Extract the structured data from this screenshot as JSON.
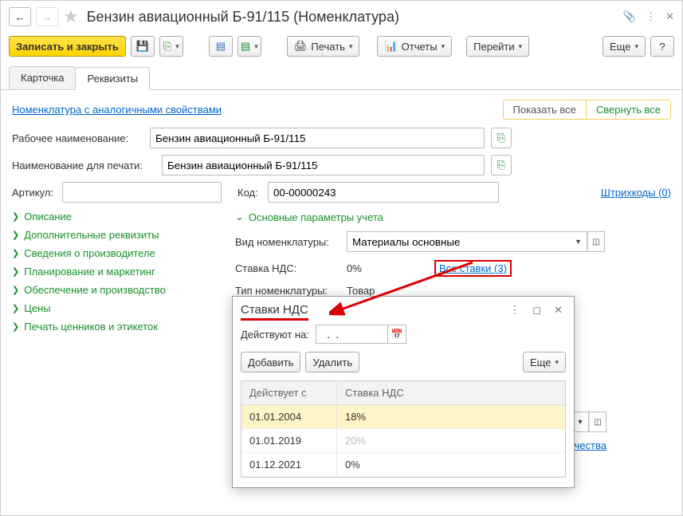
{
  "header": {
    "title": "Бензин авиационный Б-91/115 (Номенклатура)"
  },
  "toolbar": {
    "save_close": "Записать и закрыть",
    "print": "Печать",
    "reports": "Отчеты",
    "goto": "Перейти",
    "more": "Еще"
  },
  "tabs": {
    "card": "Карточка",
    "props": "Реквизиты"
  },
  "top": {
    "similar_link": "Номенклатура с аналогичными свойствами",
    "show_all": "Показать все",
    "collapse_all": "Свернуть все"
  },
  "fields": {
    "work_name_label": "Рабочее наименование:",
    "work_name_value": "Бензин авиационный Б-91/115",
    "print_name_label": "Наименование для печати:",
    "print_name_value": "Бензин авиационный Б-91/115",
    "article_label": "Артикул:",
    "article_value": "",
    "code_label": "Код:",
    "code_value": "00-00000243",
    "barcodes_link": "Штрихкоды (0)"
  },
  "tree": {
    "i0": "Описание",
    "i1": "Дополнительные реквизиты",
    "i2": "Сведения о производителе",
    "i3": "Планирование и маркетинг",
    "i4": "Обеспечение и производство",
    "i5": "Цены",
    "i6": "Печать ценников и этикеток"
  },
  "main": {
    "section_head": "Основные параметры учета",
    "kind_label": "Вид номенклатуры:",
    "kind_value": "Материалы основные",
    "vat_label": "Ставка НДС:",
    "vat_value": "0%",
    "vat_all_link": "Все ставки (3)",
    "type_label": "Тип номенклатуры:",
    "type_value": "Товар",
    "quality_link": "чества"
  },
  "popup": {
    "title": "Ставки НДС",
    "valid_on_label": "Действуют на:",
    "valid_on_value": "  .  .    ",
    "add": "Добавить",
    "delete": "Удалить",
    "more": "Еще",
    "col1": "Действует с",
    "col2": "Ставка НДС",
    "rows": [
      {
        "date": "01.01.2004",
        "rate": "18%",
        "grey": false,
        "sel": true
      },
      {
        "date": "01.01.2019",
        "rate": "20%",
        "grey": true,
        "sel": false
      },
      {
        "date": "01.12.2021",
        "rate": "0%",
        "grey": false,
        "sel": false
      }
    ]
  }
}
